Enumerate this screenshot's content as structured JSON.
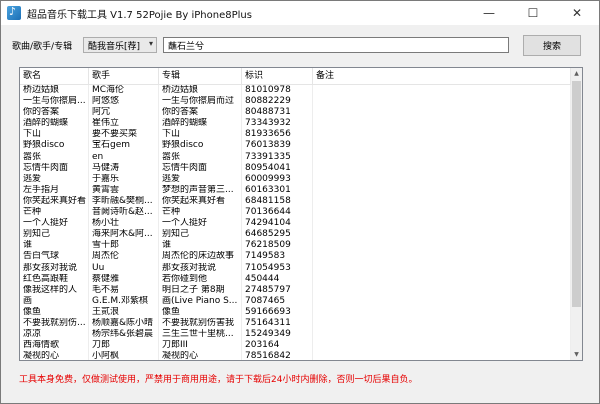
{
  "window": {
    "title": "超品音乐下载工具 V1.7 52Pojie By iPhone8Plus"
  },
  "search": {
    "label": "歌曲/歌手/专辑",
    "source_selected": "酷我音乐[荐]",
    "query": "蘸石兰兮",
    "button_label": "搜索"
  },
  "table": {
    "columns": [
      "歌名",
      "歌手",
      "专辑",
      "标识",
      "备注"
    ],
    "rows": [
      [
        "桥边姑娘",
        "MC海伦",
        "桥边姑娘",
        "81010978",
        ""
      ],
      [
        "一生与你擦肩...",
        "阿悠悠",
        "一生与你擦肩而过",
        "80882229",
        ""
      ],
      [
        "你的答案",
        "阿冗",
        "你的答案",
        "80488731",
        ""
      ],
      [
        "酒醉的蝴蝶",
        "崔伟立",
        "酒醉的蝴蝶",
        "73343932",
        ""
      ],
      [
        "下山",
        "要不要买菜",
        "下山",
        "81933656",
        ""
      ],
      [
        "野狼disco",
        "宝石gem",
        "野狼disco",
        "76013839",
        ""
      ],
      [
        "嚣张",
        "en",
        "嚣张",
        "73391335",
        ""
      ],
      [
        "忘情牛肉面",
        "马健涛",
        "忘情牛肉面",
        "80954041",
        ""
      ],
      [
        "逃爱",
        "于嘉乐",
        "逃爱",
        "60009993",
        ""
      ],
      [
        "左手指月",
        "黄霄雲",
        "梦想的声音第三...",
        "60163301",
        ""
      ],
      [
        "你笑起来真好看",
        "李昕融&樊桐...",
        "你笑起来真好看",
        "68481158",
        ""
      ],
      [
        "芒种",
        "音阙诗听&赵...",
        "芒种",
        "70136644",
        ""
      ],
      [
        "一个人挺好",
        "杨小壮",
        "一个人挺好",
        "74294104",
        ""
      ],
      [
        "别知己",
        "海来阿木&阿...",
        "别知己",
        "64685295",
        ""
      ],
      [
        "谁",
        "雪十郎",
        "谁",
        "76218509",
        ""
      ],
      [
        "告白气球",
        "周杰伦",
        "周杰伦的床边故事",
        "7149583",
        ""
      ],
      [
        "那女孩对我说",
        "Uu",
        "那女孩对我说",
        "71054953",
        ""
      ],
      [
        "红色高跟鞋",
        "蔡健雅",
        "若你碰到他",
        "450444",
        ""
      ],
      [
        "像我这样的人",
        "毛不易",
        "明日之子 第8期",
        "27485797",
        ""
      ],
      [
        "画",
        "G.E.M.邓紫棋",
        "画(Live Piano S...",
        "7087465",
        ""
      ],
      [
        "像鱼",
        "王贰浪",
        "像鱼",
        "59166693",
        ""
      ],
      [
        "不要我就别伤...",
        "杨顺嘉&陈小晴",
        "不要我就别伤害我",
        "75164311",
        ""
      ],
      [
        "凉凉",
        "杨宗纬&张碧晨",
        "三生三世十里桃...",
        "15249349",
        ""
      ],
      [
        "西海情歌",
        "刀郎",
        "刀郎III",
        "203164",
        ""
      ],
      [
        "凝视的心",
        "小阿枫",
        "凝视的心",
        "78516842",
        ""
      ]
    ]
  },
  "footer": {
    "notice": "工具本身免费，仅做测试使用，严禁用于商用用途，请于下载后24小时内删除，否则一切后果自负。"
  }
}
